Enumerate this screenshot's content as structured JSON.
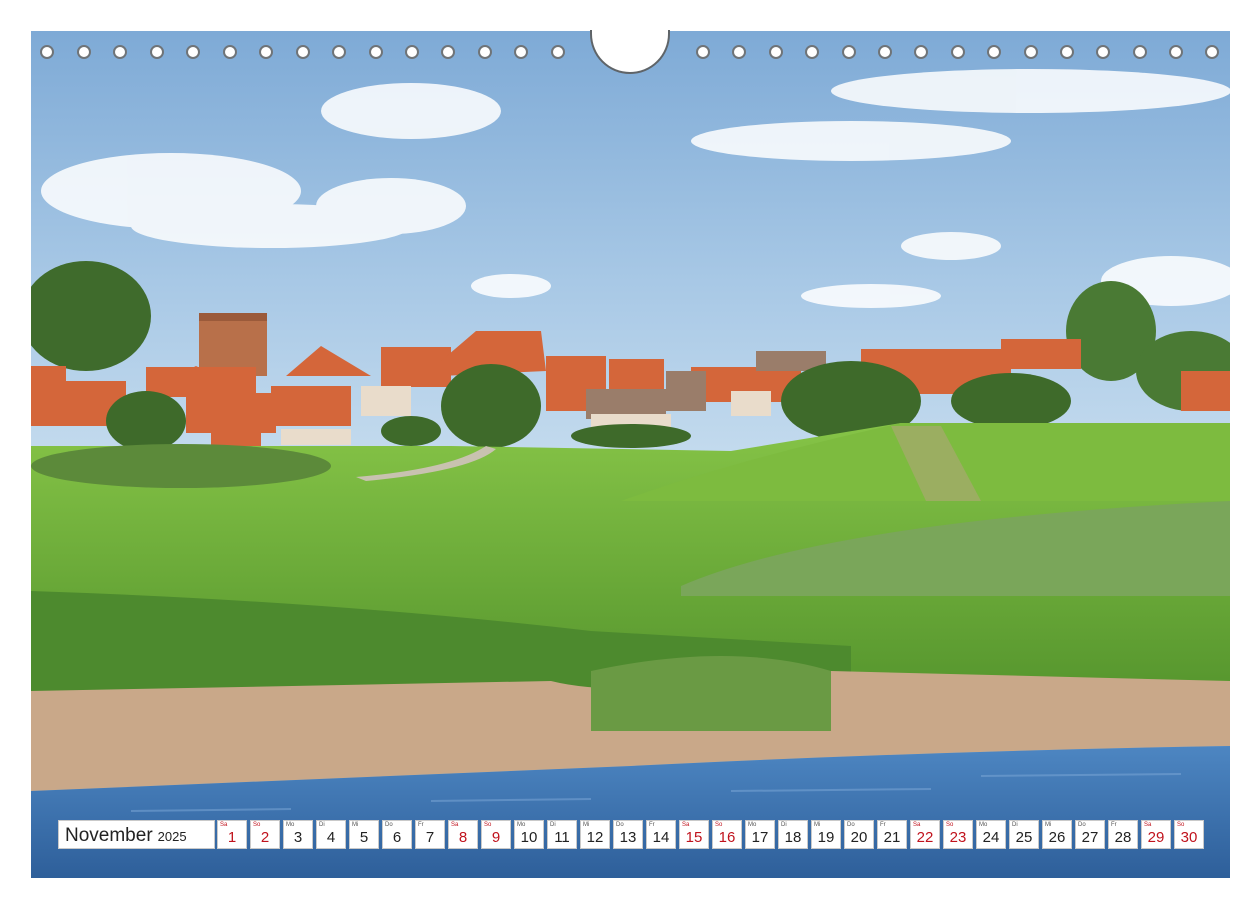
{
  "calendar": {
    "month": "November",
    "year": "2025",
    "days": [
      {
        "dow": "Sa",
        "num": "1",
        "red": true
      },
      {
        "dow": "So",
        "num": "2",
        "red": true
      },
      {
        "dow": "Mo",
        "num": "3",
        "red": false
      },
      {
        "dow": "Di",
        "num": "4",
        "red": false
      },
      {
        "dow": "Mi",
        "num": "5",
        "red": false
      },
      {
        "dow": "Do",
        "num": "6",
        "red": false
      },
      {
        "dow": "Fr",
        "num": "7",
        "red": false
      },
      {
        "dow": "Sa",
        "num": "8",
        "red": true
      },
      {
        "dow": "So",
        "num": "9",
        "red": true
      },
      {
        "dow": "Mo",
        "num": "10",
        "red": false
      },
      {
        "dow": "Di",
        "num": "11",
        "red": false
      },
      {
        "dow": "Mi",
        "num": "12",
        "red": false
      },
      {
        "dow": "Do",
        "num": "13",
        "red": false
      },
      {
        "dow": "Fr",
        "num": "14",
        "red": false
      },
      {
        "dow": "Sa",
        "num": "15",
        "red": true
      },
      {
        "dow": "So",
        "num": "16",
        "red": true
      },
      {
        "dow": "Mo",
        "num": "17",
        "red": false
      },
      {
        "dow": "Di",
        "num": "18",
        "red": false
      },
      {
        "dow": "Mi",
        "num": "19",
        "red": false
      },
      {
        "dow": "Do",
        "num": "20",
        "red": false
      },
      {
        "dow": "Fr",
        "num": "21",
        "red": false
      },
      {
        "dow": "Sa",
        "num": "22",
        "red": true
      },
      {
        "dow": "So",
        "num": "23",
        "red": true
      },
      {
        "dow": "Mo",
        "num": "24",
        "red": false
      },
      {
        "dow": "Di",
        "num": "25",
        "red": false
      },
      {
        "dow": "Mi",
        "num": "26",
        "red": false
      },
      {
        "dow": "Do",
        "num": "27",
        "red": false
      },
      {
        "dow": "Fr",
        "num": "28",
        "red": false
      },
      {
        "dow": "Sa",
        "num": "29",
        "red": true
      },
      {
        "dow": "So",
        "num": "30",
        "red": true
      }
    ]
  },
  "colors": {
    "sky": "#8fb8dc",
    "grass": "#6fae3a",
    "roof": "#d4663a",
    "water": "#3d78b8",
    "weekend": "#c0121c"
  }
}
